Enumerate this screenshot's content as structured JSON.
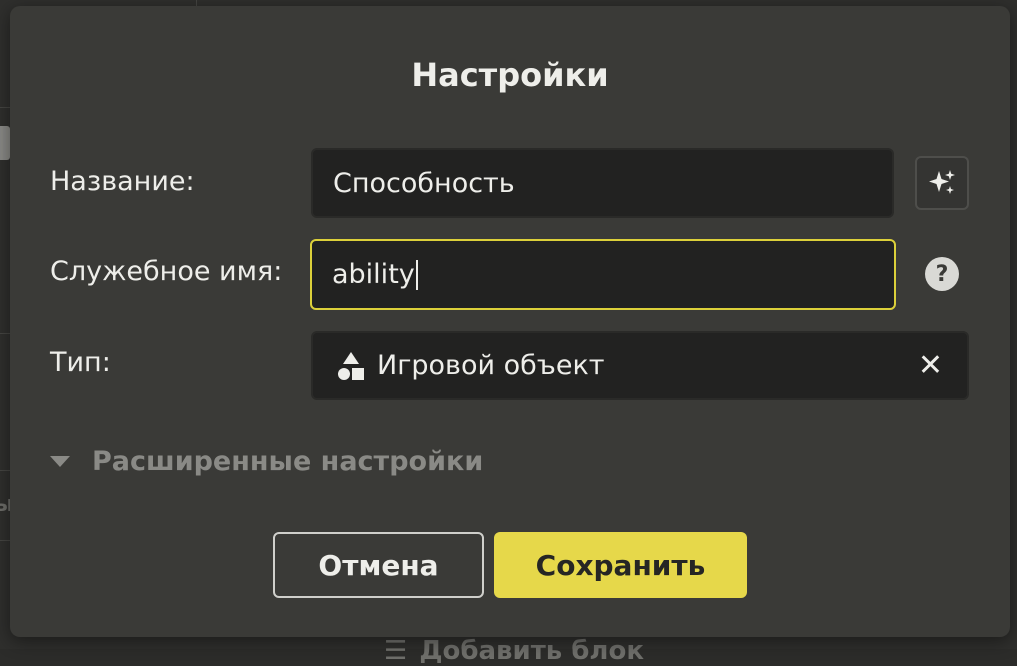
{
  "background": {
    "add_block_icon": "plus-icon",
    "add_block_label": "Добавить блок"
  },
  "dialog": {
    "title": "Настройки",
    "fields": {
      "name": {
        "label": "Название:",
        "value": "Способность",
        "action_icon": "sparkle-icon"
      },
      "service_name": {
        "label": "Служебное имя:",
        "value": "ability",
        "help_icon": "question-icon",
        "help_glyph": "?"
      },
      "type": {
        "label": "Тип:",
        "value": "Игровой объект",
        "icon": "shapes-icon",
        "clear_icon": "close-icon",
        "clear_glyph": "✕"
      }
    },
    "advanced": {
      "label": "Расширенные настройки",
      "icon": "triangle-down-icon",
      "expanded": false
    },
    "buttons": {
      "cancel": "Отмена",
      "save": "Сохранить"
    },
    "colors": {
      "accent": "#e6d84a",
      "focus_border": "#dcd03a",
      "dialog_bg": "#3a3a37",
      "input_bg": "#222221"
    }
  }
}
